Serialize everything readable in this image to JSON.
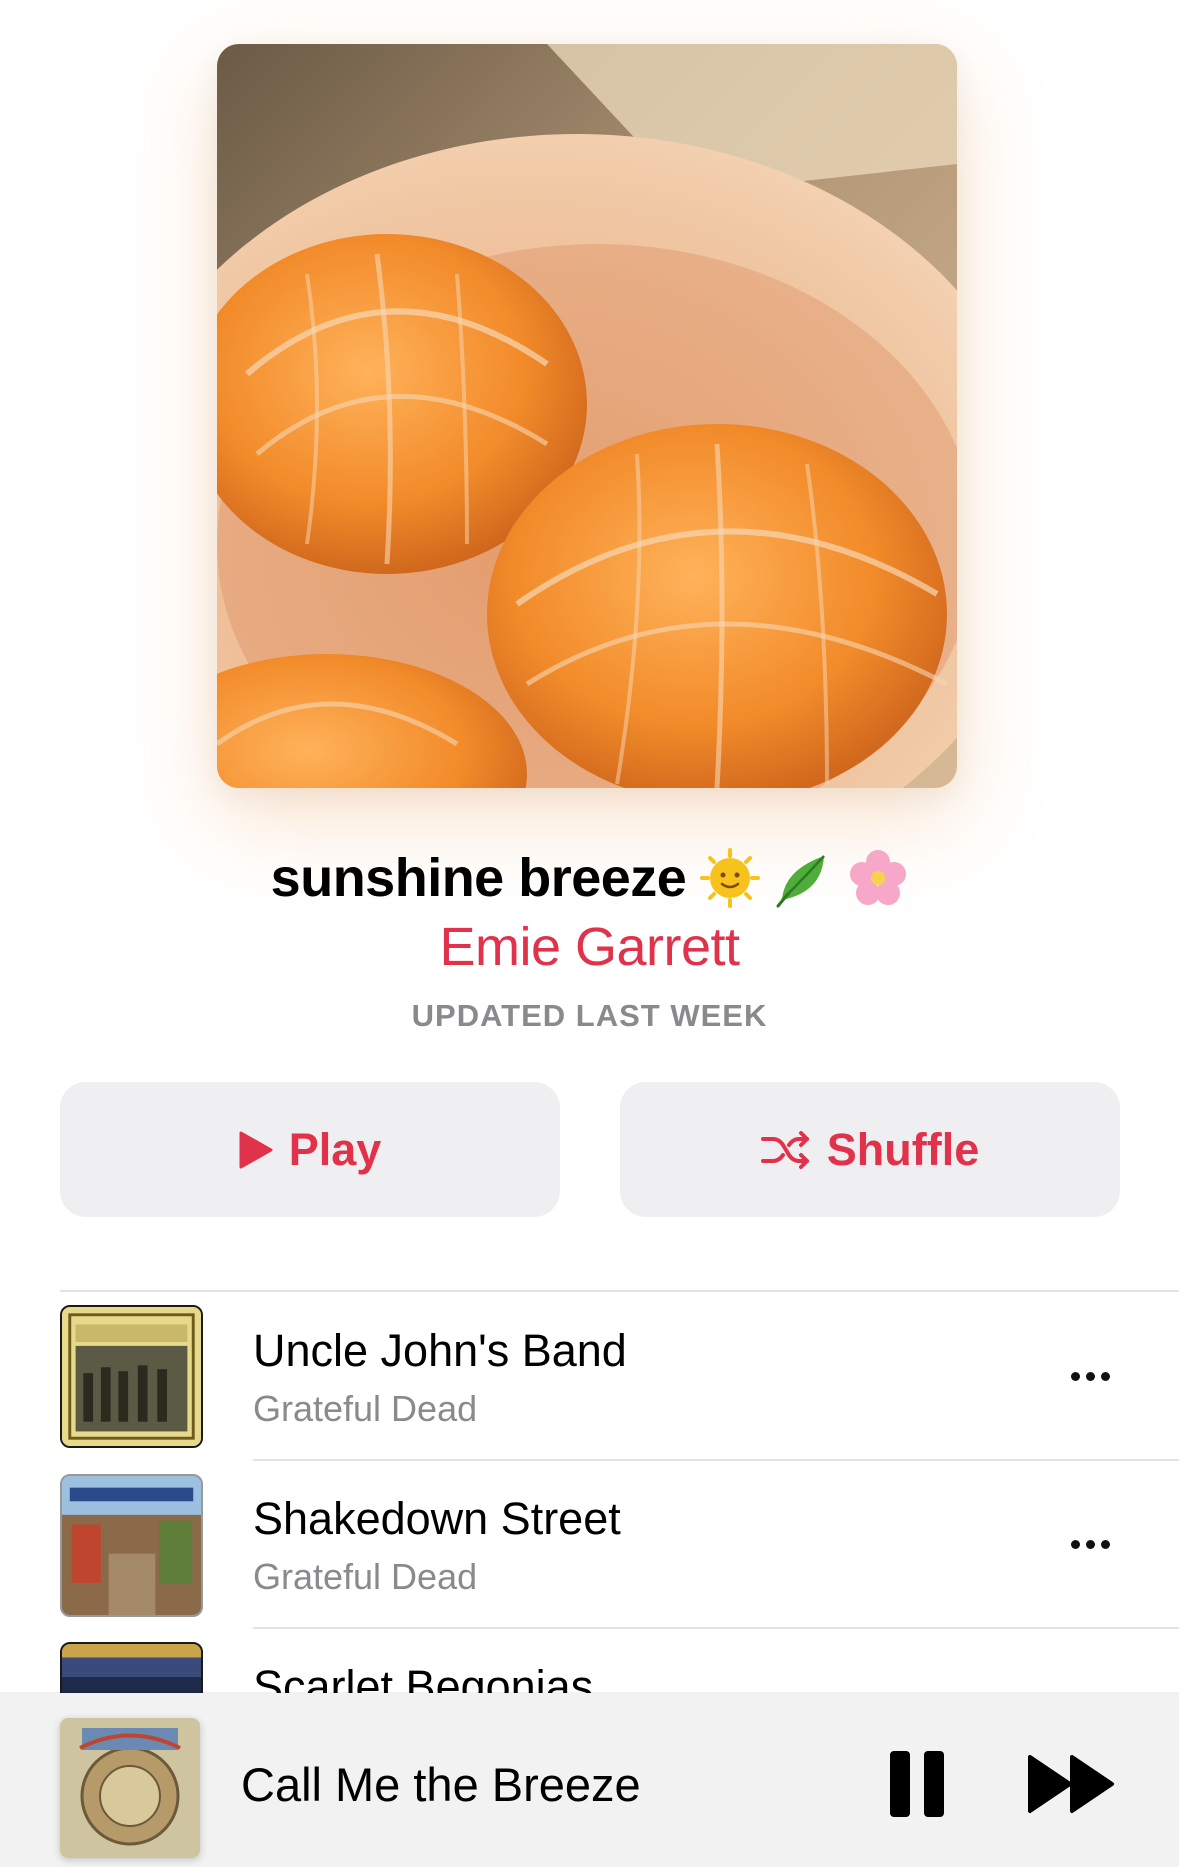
{
  "playlist": {
    "title": "sunshine breeze",
    "emojis": [
      "sun-face-emoji",
      "leaf-emoji",
      "cherry-blossom-emoji"
    ],
    "curator": "Emie Garrett",
    "updated": "UPDATED LAST WEEK"
  },
  "actions": {
    "play_label": "Play",
    "shuffle_label": "Shuffle"
  },
  "tracks": [
    {
      "title": "Uncle John's Band",
      "artist": "Grateful Dead"
    },
    {
      "title": "Shakedown Street",
      "artist": "Grateful Dead"
    },
    {
      "title": "Scarlet Begonias",
      "artist": ""
    }
  ],
  "now_playing": {
    "title": "Call Me the Breeze"
  },
  "colors": {
    "accent": "#e0334b",
    "secondary_text": "#8a8a8e",
    "button_bg": "#efeff1",
    "mini_player_bg": "#f2f2f3"
  }
}
